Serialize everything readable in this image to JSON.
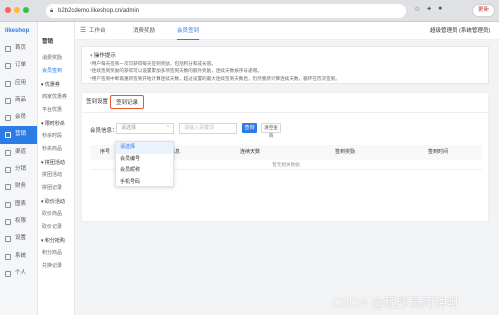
{
  "browser": {
    "url": "b2b2cdemo.likeshop.cn/admin",
    "update_label": "更新"
  },
  "sidebar": {
    "logo": "likeshop",
    "items": [
      {
        "label": "首页",
        "icon": "home-icon"
      },
      {
        "label": "订单",
        "icon": "order-icon"
      },
      {
        "label": "应用",
        "icon": "app-icon"
      },
      {
        "label": "商品",
        "icon": "goods-icon"
      },
      {
        "label": "会员",
        "icon": "member-icon"
      },
      {
        "label": "营销",
        "icon": "marketing-icon",
        "active": true
      },
      {
        "label": "渠道",
        "icon": "channel-icon"
      },
      {
        "label": "分销",
        "icon": "distribution-icon"
      },
      {
        "label": "财务",
        "icon": "finance-icon"
      },
      {
        "label": "图表",
        "icon": "chart-icon"
      },
      {
        "label": "权限",
        "icon": "permission-icon"
      },
      {
        "label": "设置",
        "icon": "settings-icon"
      },
      {
        "label": "系统",
        "icon": "system-icon"
      },
      {
        "label": "个人",
        "icon": "user-icon"
      }
    ]
  },
  "subnav": {
    "title": "营销",
    "items": [
      {
        "label": "消费奖励"
      },
      {
        "label": "会员签到",
        "active": true
      },
      {
        "label": "优惠券",
        "group": true
      },
      {
        "label": "商家优惠券"
      },
      {
        "label": "平台优惠"
      },
      {
        "label": "限时秒杀",
        "group": true
      },
      {
        "label": "秒杀时段"
      },
      {
        "label": "秒杀商品"
      },
      {
        "label": "拼团活动",
        "group": true
      },
      {
        "label": "拼团活动"
      },
      {
        "label": "拼团记录"
      },
      {
        "label": "砍价活动",
        "group": true
      },
      {
        "label": "砍价商品"
      },
      {
        "label": "砍价记录"
      },
      {
        "label": "积分抢购",
        "group": true
      },
      {
        "label": "积分商品"
      },
      {
        "label": "兑换记录"
      }
    ]
  },
  "topbar": {
    "tabs": [
      "工作台",
      "消费奖励",
      "会员签到"
    ],
    "user": "超级管理员 (系统管理员)"
  },
  "notice": {
    "title": "操作提示",
    "lines": [
      "*用户每天签到一次可获得每天签到奖励，包括积分和成长值。",
      "*连续签到奖励的获得可以设置累加多项签到天数的额外奖励，连续天数按序号递增。",
      "*用户签到中断再重新签到开始计算连续天数，超过设置的最大连续签到天数后，仍然重新计算连续天数，循环在历次签到。"
    ]
  },
  "panel": {
    "tabs": [
      "签到设置",
      "签到记录"
    ],
    "active_tab": 1,
    "filter": {
      "label": "会员信息：",
      "select_placeholder": "请选择",
      "input_placeholder": "请输入关键词",
      "query_label": "查询",
      "reset_label": "清空查询"
    },
    "columns": [
      "序号",
      "会员信息",
      "连续天数",
      "签到奖励",
      "签到时间"
    ],
    "empty_text": "暂无相关数据"
  },
  "dropdown": {
    "options": [
      "请选择",
      "会员编号",
      "会员昵称",
      "手机号码"
    ],
    "highlighted": 0
  },
  "watermark": "CSDN @程序员阿钟呀",
  "colors": {
    "accent": "#2d7be5",
    "tab_highlight": "#e05a2b"
  }
}
